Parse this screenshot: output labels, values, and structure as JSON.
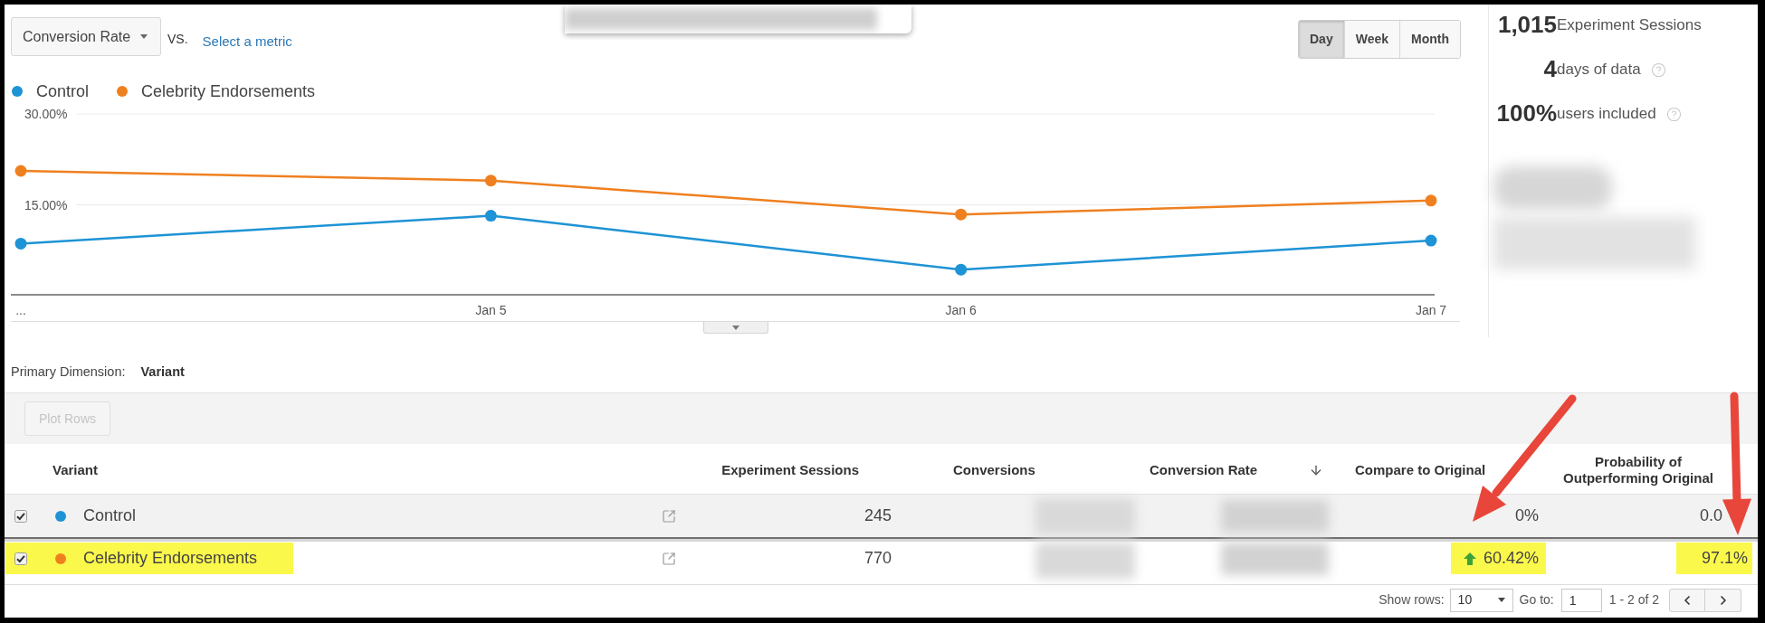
{
  "metric_picker": {
    "metric": "Conversion Rate",
    "vs_label": "VS.",
    "compare_link": "Select a metric"
  },
  "granularity": [
    {
      "label": "Day",
      "selected": true
    },
    {
      "label": "Week",
      "selected": false
    },
    {
      "label": "Month",
      "selected": false
    }
  ],
  "chart": {
    "chart_data": {
      "type": "line",
      "categories": [
        "...",
        "Jan 5",
        "Jan 6",
        "Jan 7"
      ],
      "series": [
        {
          "name": "Control",
          "color": "#1e93d5",
          "marker": "circle",
          "values": [
            8.6,
            13.2,
            4.3,
            9.1
          ]
        },
        {
          "name": "Celebrity Endorsements",
          "color": "#ef8020",
          "marker": "circle",
          "values": [
            20.6,
            19.0,
            13.4,
            15.7
          ]
        }
      ],
      "ylim": [
        0,
        30
      ],
      "yticks": [
        {
          "value": 15,
          "label": "15.00%"
        },
        {
          "value": 30,
          "label": "30.00%"
        }
      ]
    }
  },
  "stats": [
    {
      "value": "1,015",
      "label": "Experiment Sessions",
      "help": false
    },
    {
      "value": "4",
      "label": "days of data",
      "help": true
    },
    {
      "value": "100%",
      "label": "users included",
      "help": true
    }
  ],
  "dimension": {
    "label": "Primary Dimension:",
    "value": "Variant"
  },
  "plot_rows": {
    "label": "Plot Rows",
    "disabled": true
  },
  "table": {
    "columns": [
      {
        "label": "Variant",
        "sorted": false
      },
      {
        "label": "Experiment Sessions",
        "sorted": false
      },
      {
        "label": "Conversions",
        "sorted": false
      },
      {
        "label": "Conversion Rate",
        "sorted": true
      },
      {
        "label": "Compare to Original",
        "sorted": false
      },
      {
        "label": "Probability of Outperforming Original",
        "sorted": false
      }
    ],
    "rows": [
      {
        "checked": true,
        "hovered": true,
        "color": "#1e93d5",
        "name": {
          "text": "Control",
          "highlighted": false
        },
        "sessions": "245",
        "compare": {
          "text": "0%",
          "up_arrow": false,
          "highlighted": false
        },
        "probability": {
          "text": "0.0",
          "highlighted": false
        }
      },
      {
        "checked": true,
        "hovered": false,
        "color": "#ef8020",
        "name": {
          "text": "Celebrity Endorsements",
          "highlighted": true
        },
        "sessions": "770",
        "compare": {
          "text": "60.42%",
          "up_arrow": true,
          "highlighted": true
        },
        "probability": {
          "text": "97.1%",
          "highlighted": true
        }
      }
    ]
  },
  "pagination": {
    "show_rows_label": "Show rows:",
    "rows_per_page": "10",
    "goto_label": "Go to:",
    "page": "1",
    "range": "1 - 2 of 2"
  }
}
